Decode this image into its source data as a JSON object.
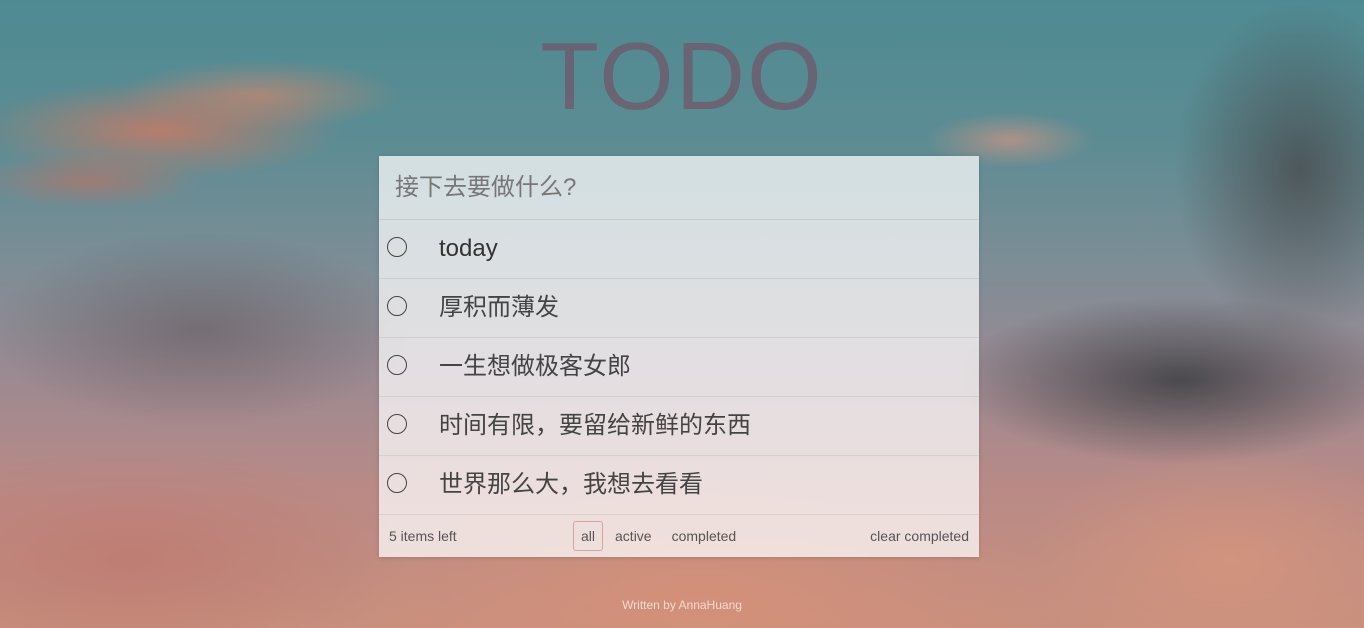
{
  "header": {
    "title": "TODO"
  },
  "input": {
    "placeholder": "接下去要做什么?"
  },
  "todos": [
    {
      "label": "today",
      "completed": false
    },
    {
      "label": "厚积而薄发",
      "completed": false
    },
    {
      "label": "一生想做极客女郎",
      "completed": false
    },
    {
      "label": "时间有限，要留给新鲜的东西",
      "completed": false
    },
    {
      "label": "世界那么大，我想去看看",
      "completed": false
    }
  ],
  "footer": {
    "items_left": "5 items left",
    "filters": [
      {
        "label": "all",
        "selected": true
      },
      {
        "label": "active",
        "selected": false
      },
      {
        "label": "completed",
        "selected": false
      }
    ],
    "clear_completed": "clear completed"
  },
  "credit": "Written by AnnaHuang",
  "colors": {
    "title": "#8a4a5a",
    "selected_filter_border": "#c98b8b"
  }
}
